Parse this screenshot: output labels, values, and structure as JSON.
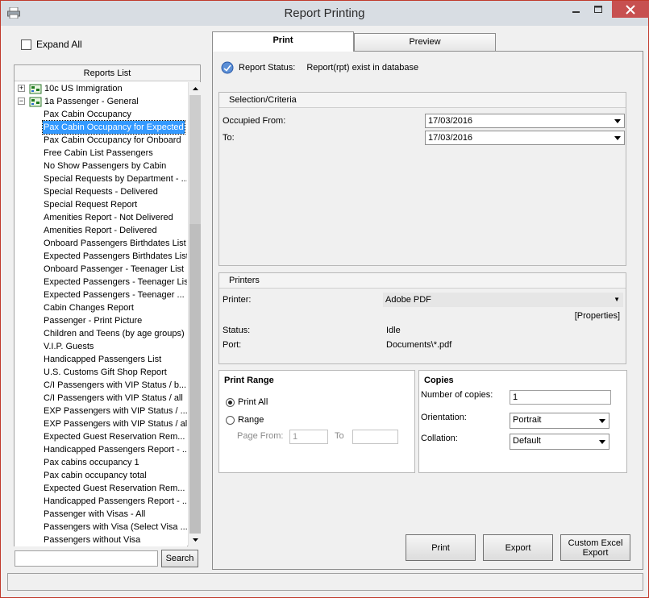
{
  "window": {
    "title": "Report Printing"
  },
  "left": {
    "expand_all_label": "Expand All",
    "reports_list_header": "Reports List",
    "tree": [
      {
        "label": "10c US Immigration",
        "level": 0,
        "expander": "+"
      },
      {
        "label": "1a  Passenger - General",
        "level": 0,
        "expander": "−"
      },
      {
        "label": "Pax Cabin Occupancy",
        "level": 1
      },
      {
        "label": "Pax Cabin Occupancy for Expected",
        "level": 1,
        "selected": true
      },
      {
        "label": "Pax Cabin Occupancy for Onboard",
        "level": 1
      },
      {
        "label": "Free Cabin List Passengers",
        "level": 1
      },
      {
        "label": "No Show Passengers by Cabin",
        "level": 1
      },
      {
        "label": "Special Requests by Department - ...",
        "level": 1
      },
      {
        "label": "Special Requests - Delivered",
        "level": 1
      },
      {
        "label": "Special Request Report",
        "level": 1
      },
      {
        "label": "Amenities Report - Not Delivered",
        "level": 1
      },
      {
        "label": "Amenities Report - Delivered",
        "level": 1
      },
      {
        "label": "Onboard Passengers Birthdates List",
        "level": 1
      },
      {
        "label": "Expected Passengers Birthdates List",
        "level": 1
      },
      {
        "label": "Onboard Passenger - Teenager List",
        "level": 1
      },
      {
        "label": "Expected Passengers - Teenager List",
        "level": 1
      },
      {
        "label": "Expected Passengers - Teenager ...",
        "level": 1
      },
      {
        "label": "Cabin Changes Report",
        "level": 1
      },
      {
        "label": "Passenger - Print Picture",
        "level": 1
      },
      {
        "label": "Children and Teens (by age groups)",
        "level": 1
      },
      {
        "label": "V.I.P. Guests",
        "level": 1
      },
      {
        "label": "Handicapped Passengers List",
        "level": 1
      },
      {
        "label": "U.S. Customs Gift Shop Report",
        "level": 1
      },
      {
        "label": "C/I Passengers with VIP Status / b...",
        "level": 1
      },
      {
        "label": "C/I Passengers with VIP Status / all",
        "level": 1
      },
      {
        "label": "EXP Passengers with VIP Status / ...",
        "level": 1
      },
      {
        "label": "EXP Passengers with VIP Status / all",
        "level": 1
      },
      {
        "label": "Expected Guest Reservation Rem...",
        "level": 1
      },
      {
        "label": "Handicapped Passengers Report - ...",
        "level": 1
      },
      {
        "label": "Pax cabins occupancy 1",
        "level": 1
      },
      {
        "label": "Pax cabin occupancy total",
        "level": 1
      },
      {
        "label": "Expected Guest Reservation Rem...",
        "level": 1
      },
      {
        "label": "Handicapped Passengers Report - ...",
        "level": 1
      },
      {
        "label": "Passenger with Visas - All",
        "level": 1
      },
      {
        "label": "Passengers with Visa  (Select Visa ...",
        "level": 1
      },
      {
        "label": "Passengers without Visa",
        "level": 1
      }
    ],
    "search_value": "",
    "search_button": "Search"
  },
  "tabs": {
    "print": "Print",
    "preview": "Preview"
  },
  "status": {
    "label": "Report Status:",
    "value": "Report(rpt) exist in database"
  },
  "selection": {
    "header": "Selection/Criteria",
    "occupied_from_label": "Occupied From:",
    "occupied_from_value": "17/03/2016",
    "to_label": "To:",
    "to_value": "17/03/2016"
  },
  "printers": {
    "header": "Printers",
    "printer_label": "Printer:",
    "printer_value": "Adobe PDF",
    "properties_link": "[Properties]",
    "status_label": "Status:",
    "status_value": "Idle",
    "port_label": "Port:",
    "port_value": "Documents\\*.pdf"
  },
  "print_range": {
    "title": "Print Range",
    "print_all": "Print All",
    "range": "Range",
    "page_from_label": "Page From:",
    "page_from_value": "1",
    "to_label": "To",
    "to_value": ""
  },
  "copies": {
    "title": "Copies",
    "number_label": "Number of copies:",
    "number_value": "1",
    "orientation_label": "Orientation:",
    "orientation_value": "Portrait",
    "collation_label": "Collation:",
    "collation_value": "Default"
  },
  "actions": {
    "print": "Print",
    "export": "Export",
    "custom_excel_export": "Custom Excel Export"
  },
  "colors": {
    "selection": "#3399ff",
    "close_button": "#c75050",
    "window_border": "#c0392b"
  }
}
